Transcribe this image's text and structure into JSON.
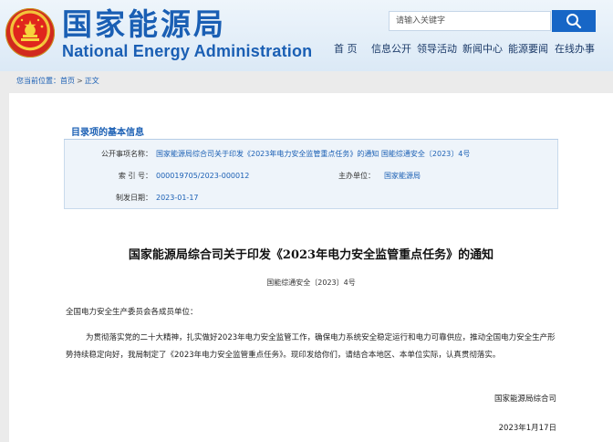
{
  "header": {
    "logo_cn": "国家能源局",
    "logo_en": "National Energy Administration",
    "search_placeholder": "请输入关键字"
  },
  "nav": {
    "items": [
      "首 页",
      "信息公开",
      "领导活动",
      "新闻中心",
      "能源要闻",
      "在线办事"
    ]
  },
  "breadcrumb": {
    "prefix": "您当前位置：",
    "home": "首页",
    "separator": ">",
    "current": "正文"
  },
  "info": {
    "title": "目录项的基本信息",
    "fields": {
      "subject_label": "公开事项名称：",
      "subject_value": "国家能源局综合司关于印发《2023年电力安全监管重点任务》的通知 国能综通安全〔2023〕4号",
      "index_label": "索 引 号：",
      "index_value": "000019705/2023-000012",
      "owner_label": "主办单位：",
      "owner_value": "国家能源局",
      "date_label": "制发日期：",
      "date_value": "2023-01-17"
    }
  },
  "document": {
    "title": "国家能源局综合司关于印发《2023年电力安全监管重点任务》的通知",
    "number": "国能综通安全〔2023〕4号",
    "addressee": "全国电力安全生产委员会各成员单位：",
    "body": "为贯彻落实党的二十大精神，扎实做好2023年电力安全监管工作，确保电力系统安全稳定运行和电力可靠供应，推动全国电力安全生产形势持续稳定向好，我局制定了《2023年电力安全监管重点任务》。现印发给你们，请结合本地区、本单位实际，认真贯彻落实。",
    "signature": "国家能源局综合司",
    "date": "2023年1月17日"
  },
  "colors": {
    "brand_blue": "#1a5fb4",
    "search_button": "#1766c6"
  }
}
